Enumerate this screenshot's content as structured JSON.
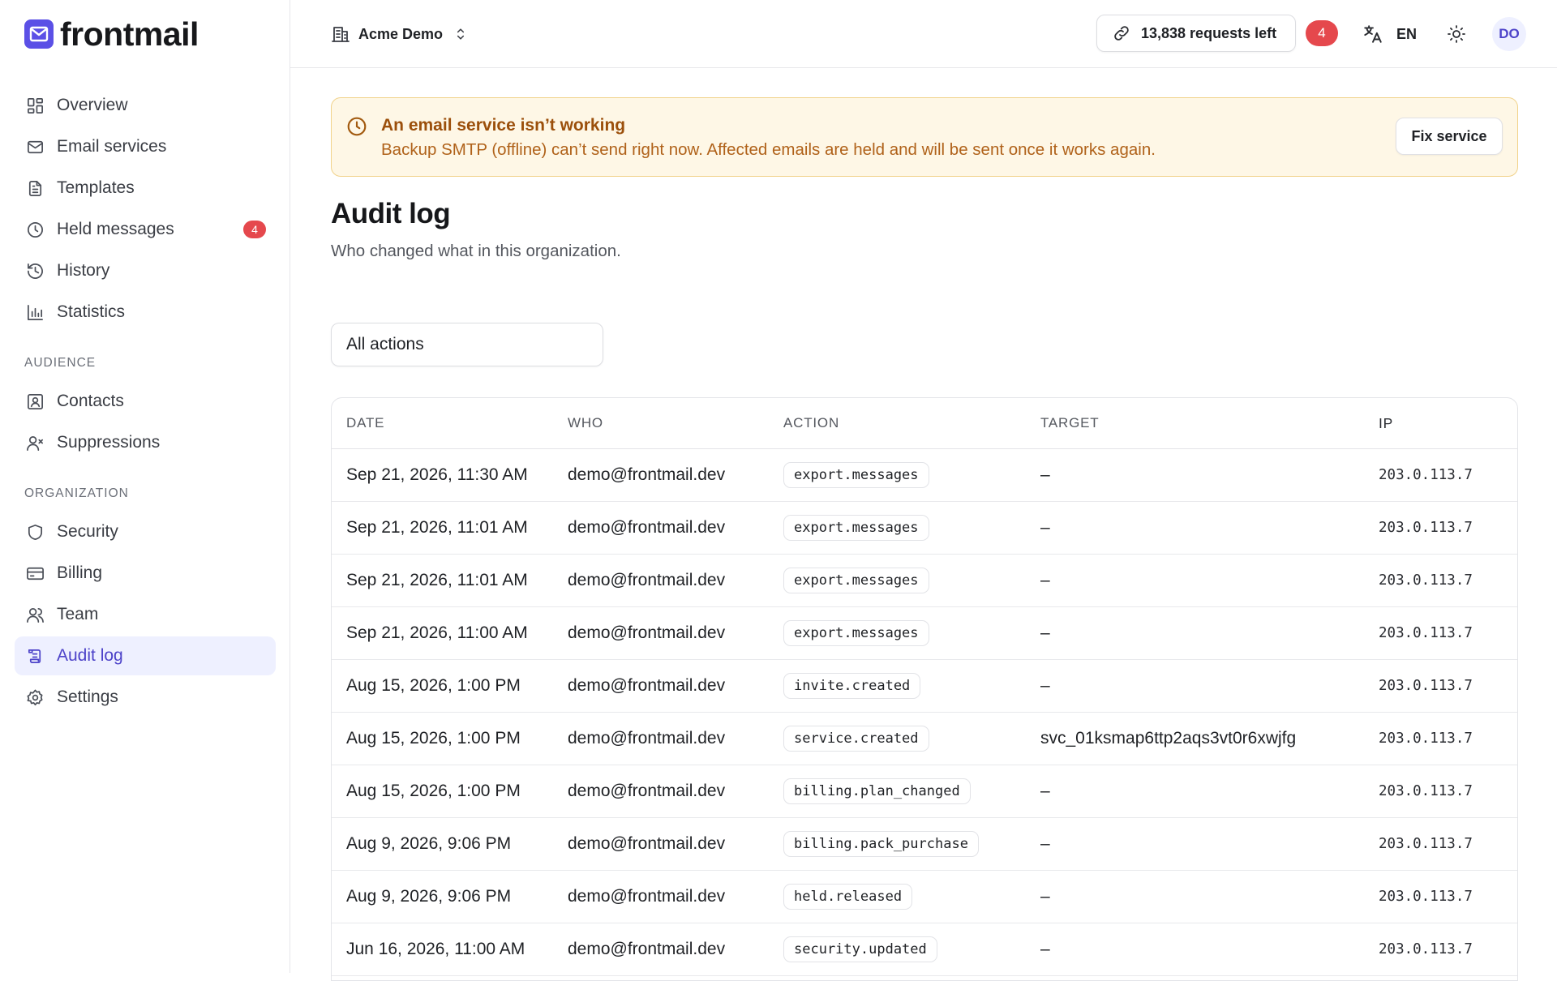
{
  "brand": {
    "name": "frontmail",
    "accent": "#5b50e6"
  },
  "sidebar": {
    "items": [
      {
        "label": "Overview",
        "icon": "dashboard-icon"
      },
      {
        "label": "Email services",
        "icon": "mail-icon"
      },
      {
        "label": "Templates",
        "icon": "document-icon"
      },
      {
        "label": "Held messages",
        "icon": "clock-icon",
        "badge": "4"
      },
      {
        "label": "History",
        "icon": "history-icon"
      },
      {
        "label": "Statistics",
        "icon": "bar-chart-icon"
      }
    ],
    "audience_heading": "AUDIENCE",
    "audience_items": [
      {
        "label": "Contacts",
        "icon": "contact-card-icon"
      },
      {
        "label": "Suppressions",
        "icon": "user-x-icon"
      }
    ],
    "organization_heading": "ORGANIZATION",
    "organization_items": [
      {
        "label": "Security",
        "icon": "shield-icon"
      },
      {
        "label": "Billing",
        "icon": "credit-card-icon"
      },
      {
        "label": "Team",
        "icon": "users-icon"
      },
      {
        "label": "Audit log",
        "icon": "scroll-icon",
        "active": true
      },
      {
        "label": "Settings",
        "icon": "gear-icon"
      }
    ]
  },
  "topbar": {
    "org_name": "Acme Demo",
    "requests": "13,838 requests left",
    "notifications_badge": "4",
    "language": "EN",
    "avatar_initials": "DO"
  },
  "alert": {
    "title": "An email service isn’t working",
    "body": "Backup SMTP (offline) can’t send right now. Affected emails are held and will be sent once it works again.",
    "button": "Fix service"
  },
  "page": {
    "title": "Audit log",
    "subtitle": "Who changed what in this organization."
  },
  "filter": {
    "value": "All actions"
  },
  "table": {
    "headers": {
      "date": "DATE",
      "who": "WHO",
      "action": "ACTION",
      "target": "TARGET",
      "ip": "IP"
    },
    "rows": [
      {
        "date": "Sep 21, 2026, 11:30 AM",
        "who": "demo@frontmail.dev",
        "action": "export.messages",
        "target": "–",
        "ip": "203.0.113.7"
      },
      {
        "date": "Sep 21, 2026, 11:01 AM",
        "who": "demo@frontmail.dev",
        "action": "export.messages",
        "target": "–",
        "ip": "203.0.113.7"
      },
      {
        "date": "Sep 21, 2026, 11:01 AM",
        "who": "demo@frontmail.dev",
        "action": "export.messages",
        "target": "–",
        "ip": "203.0.113.7"
      },
      {
        "date": "Sep 21, 2026, 11:00 AM",
        "who": "demo@frontmail.dev",
        "action": "export.messages",
        "target": "–",
        "ip": "203.0.113.7"
      },
      {
        "date": "Aug 15, 2026, 1:00 PM",
        "who": "demo@frontmail.dev",
        "action": "invite.created",
        "target": "–",
        "ip": "203.0.113.7"
      },
      {
        "date": "Aug 15, 2026, 1:00 PM",
        "who": "demo@frontmail.dev",
        "action": "service.created",
        "target": "svc_01ksmap6ttp2aqs3vt0r6xwjfg",
        "ip": "203.0.113.7"
      },
      {
        "date": "Aug 15, 2026, 1:00 PM",
        "who": "demo@frontmail.dev",
        "action": "billing.plan_changed",
        "target": "–",
        "ip": "203.0.113.7"
      },
      {
        "date": "Aug 9, 2026, 9:06 PM",
        "who": "demo@frontmail.dev",
        "action": "billing.pack_purchase",
        "target": "–",
        "ip": "203.0.113.7"
      },
      {
        "date": "Aug 9, 2026, 9:06 PM",
        "who": "demo@frontmail.dev",
        "action": "held.released",
        "target": "–",
        "ip": "203.0.113.7"
      },
      {
        "date": "Jun 16, 2026, 11:00 AM",
        "who": "demo@frontmail.dev",
        "action": "security.updated",
        "target": "–",
        "ip": "203.0.113.7"
      },
      {
        "date": "",
        "who": "",
        "action": "",
        "target": "",
        "ip": ""
      }
    ]
  }
}
